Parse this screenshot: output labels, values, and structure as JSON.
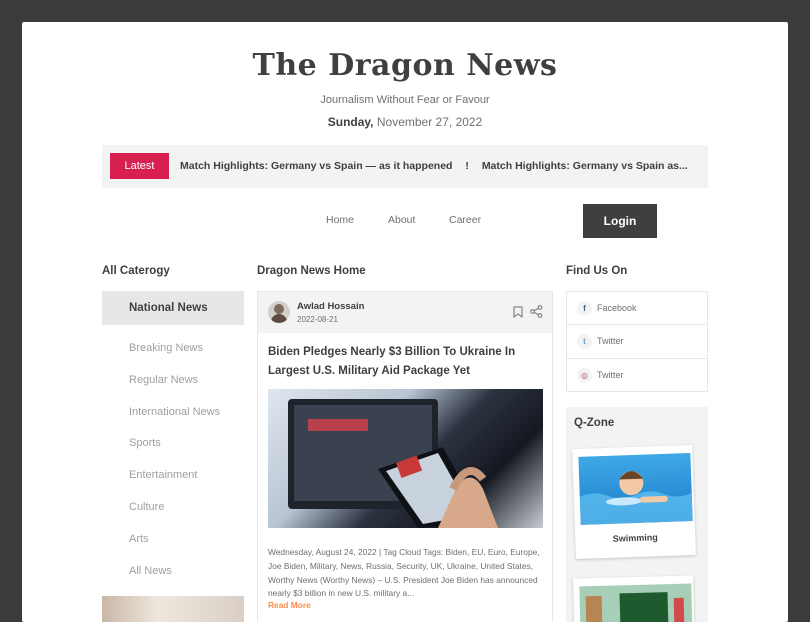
{
  "header": {
    "logo": "The Dragon News",
    "tagline": "Journalism Without Fear or Favour",
    "date_day": "Sunday,",
    "date_rest": " November 27, 2022"
  },
  "ticker": {
    "badge": "Latest",
    "items": [
      "Match Highlights: Germany vs Spain — as it happened",
      "!",
      "Match Highlights: Germany vs Spain as..."
    ]
  },
  "nav": {
    "items": [
      "Home",
      "About",
      "Career"
    ],
    "login": "Login"
  },
  "left": {
    "title": "All Caterogy",
    "active": "National News",
    "categories": [
      "Breaking News",
      "Regular News",
      "International News",
      "Sports",
      "Entertainment",
      "Culture",
      "Arts",
      "All News"
    ]
  },
  "main": {
    "title": "Dragon News Home",
    "article": {
      "author": "Awlad Hossain",
      "date": "2022-08-21",
      "headline": "Biden Pledges Nearly $3 Billion To Ukraine In Largest U.S. Military Aid Package Yet",
      "excerpt": "Wednesday, August 24, 2022 | Tag Cloud Tags: Biden, EU, Euro, Europe, Joe Biden, Military, News, Russia, Security, UK, Ukraine, United States, Worthy News (Worthy News) – U.S. President Joe Biden has announced nearly $3 billion in new U.S. military a...",
      "read_more": "Read More"
    }
  },
  "right": {
    "find_title": "Find Us On",
    "social": [
      {
        "label": "Facebook",
        "icon": "facebook-icon",
        "color": "#3b5998",
        "glyph": "f"
      },
      {
        "label": "Twitter",
        "icon": "twitter-icon",
        "color": "#58a7de",
        "glyph": "t"
      },
      {
        "label": "Twitter",
        "icon": "instagram-icon",
        "color": "#d82d7e",
        "glyph": "◎"
      }
    ],
    "qzone_title": "Q-Zone",
    "qzone_items": [
      "Swimming"
    ]
  },
  "colors": {
    "accent": "#d72050",
    "dark": "#403f3f",
    "muted": "#706f6f",
    "read_more": "#ff8c47"
  }
}
